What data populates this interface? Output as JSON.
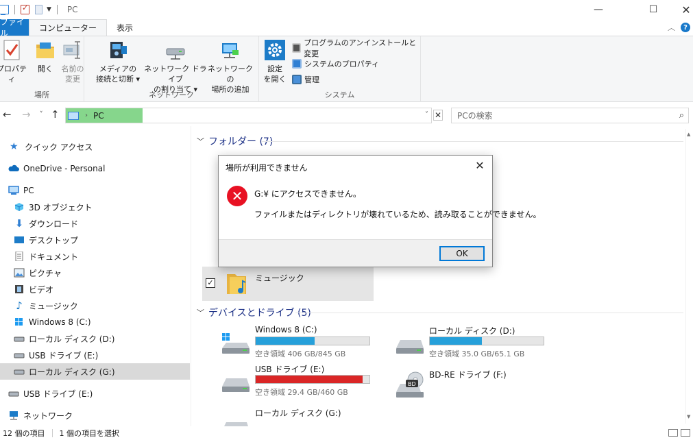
{
  "window": {
    "title": "PC"
  },
  "ribbon_tabs": {
    "file": "ファイル",
    "computer": "コンピューター",
    "view": "表示"
  },
  "ribbon": {
    "location": {
      "label": "場所",
      "properties": "プロパティ",
      "open": "開く",
      "rename_line1": "名前の",
      "rename_line2": "変更"
    },
    "network": {
      "label": "ネットワーク",
      "media_line1": "メディアの",
      "media_line2": "接続と切断",
      "map_line1": "ネットワーク ドライブ",
      "map_line2": "の割り当て",
      "add_line1": "ネットワークの",
      "add_line2": "場所の追加"
    },
    "system": {
      "label": "システム",
      "settings_line1": "設定",
      "settings_line2": "を開く",
      "uninstall": "プログラムのアンインストールと変更",
      "sysprops": "システムのプロパティ",
      "manage": "管理"
    }
  },
  "address": {
    "path": "PC",
    "progress": 0.21
  },
  "search": {
    "placeholder": "PCの検索"
  },
  "nav": {
    "items": [
      {
        "label": "クイック アクセス"
      },
      {
        "label": "OneDrive - Personal"
      },
      {
        "label": "PC"
      },
      {
        "label": "3D オブジェクト"
      },
      {
        "label": "ダウンロード"
      },
      {
        "label": "デスクトップ"
      },
      {
        "label": "ドキュメント"
      },
      {
        "label": "ピクチャ"
      },
      {
        "label": "ビデオ"
      },
      {
        "label": "ミュージック"
      },
      {
        "label": "Windows 8 (C:)"
      },
      {
        "label": "ローカル ディスク (D:)"
      },
      {
        "label": "USB ドライブ (E:)"
      },
      {
        "label": "ローカル ディスク (G:)"
      },
      {
        "label": "USB ドライブ (E:)"
      },
      {
        "label": "ネットワーク"
      }
    ]
  },
  "main": {
    "folders_header": "フォルダー (7)",
    "devices_header": "デバイスとドライブ (5)",
    "music_label": "ミュージック",
    "drives": [
      {
        "name": "Windows 8 (C:)",
        "free": "空き領域 406 GB/845 GB",
        "used_fraction": 0.52,
        "color": "#26a0da"
      },
      {
        "name": "ローカル ディスク (D:)",
        "free": "空き領域 35.0 GB/65.1 GB",
        "used_fraction": 0.46,
        "color": "#26a0da"
      },
      {
        "name": "USB ドライブ (E:)",
        "free": "空き領域 29.4 GB/460 GB",
        "used_fraction": 0.94,
        "color": "#da2626"
      },
      {
        "name": "BD-RE ドライブ (F:)",
        "free": "",
        "used_fraction": null,
        "color": ""
      },
      {
        "name": "ローカル ディスク (G:)",
        "free": "",
        "used_fraction": null,
        "color": ""
      }
    ]
  },
  "status": {
    "count": "12 個の項目",
    "selected": "1 個の項目を選択"
  },
  "dialog": {
    "title": "場所が利用できません",
    "message1": "G:¥ にアクセスできません。",
    "message2": "ファイルまたはディレクトリが壊れているため、読み取ることができません。",
    "ok": "OK"
  }
}
